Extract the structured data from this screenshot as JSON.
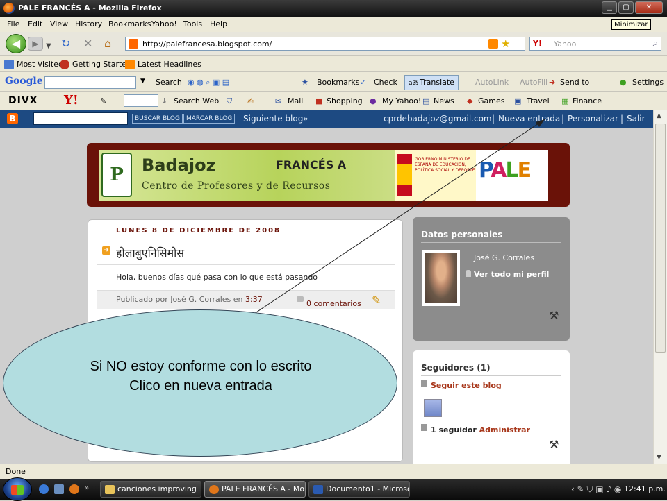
{
  "window": {
    "title": "PALE FRANCÉS A - Mozilla Firefox",
    "tooltip": "Minimizar"
  },
  "menu": [
    "File",
    "Edit",
    "View",
    "History",
    "Bookmarks",
    "Yahoo!",
    "Tools",
    "Help"
  ],
  "nav": {
    "url": "http://palefrancesa.blogspot.com/",
    "search_placeholder": "Yahoo",
    "search_engine_label": "Y!"
  },
  "bookmarks": [
    "Most Visited",
    "Getting Started",
    "Latest Headlines"
  ],
  "google_toolbar": {
    "logo": "Google",
    "items": [
      "Search",
      "Bookmarks",
      "Check",
      "Translate",
      "AutoLink",
      "AutoFill",
      "Send to",
      "Settings"
    ]
  },
  "yahoo_toolbar": {
    "divx": "DIVX",
    "yahoo": "Y!",
    "items": [
      "Search Web",
      "Mail",
      "Shopping",
      "My Yahoo!",
      "News",
      "Games",
      "Travel",
      "Finance"
    ]
  },
  "blogger_nav": {
    "buttons": [
      "BUSCAR BLOG",
      "MARCAR BLOG"
    ],
    "next": "Siguiente blog»",
    "email": "cprdebadajoz@gmail.com",
    "new_post": "Nueva entrada",
    "customize": "Personalizar",
    "logout": "Salir",
    "sep": "|"
  },
  "banner": {
    "badajoz": "Badajoz",
    "francesa": "FRANCÉS A",
    "subtitle": "Centro de Profesores y de Recursos",
    "logo_letter": "P",
    "gov_text": "GOBIERNO MINISTERIO DE ESPAÑA DE EDUCACIÓN, POLÍTICA SOCIAL Y DEPORTE",
    "pale": "PALE"
  },
  "post": {
    "date": "LUNES 8 DE DICIEMBRE DE 2008",
    "title": "होलाबुएनिसिमोस",
    "body": "Hola, buenos días qué pasa con lo que está pasando",
    "published_by": "Publicado por José G. Corrales en",
    "time": "3:37",
    "comments": "0 comentarios"
  },
  "sidebar": {
    "profile_heading": "Datos personales",
    "name": "José G. Corrales",
    "view_profile": "Ver todo mi perfil",
    "followers_heading": "Seguidores (1)",
    "follow_link": "Seguir este blog",
    "follower_count": "1 seguidor",
    "admin": "Administrar"
  },
  "callout": {
    "line1": "Si   NO estoy conforme con lo escrito",
    "line2": "Clico en nueva entrada"
  },
  "status": "Done",
  "taskbar": {
    "tasks": [
      "canciones improving",
      "PALE FRANCÉS A - Mo...",
      "Documento1 - Microso..."
    ],
    "clock": "12:41 p.m."
  }
}
